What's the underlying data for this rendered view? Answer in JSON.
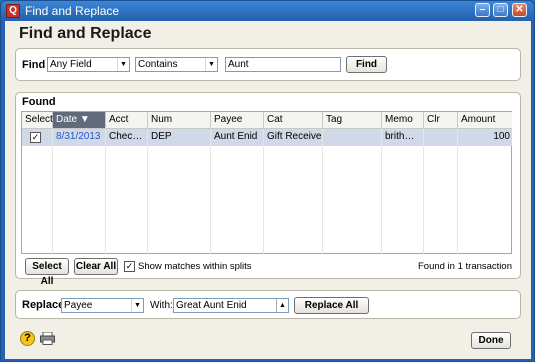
{
  "window": {
    "title": "Find and Replace",
    "min_glyph": "–",
    "max_glyph": "□",
    "close_glyph": "✕",
    "app_icon_glyph": "Q"
  },
  "heading": "Find and Replace",
  "find": {
    "label": "Find",
    "field_value": "Any Field",
    "operator_value": "Contains",
    "text_value": "Aunt",
    "button_label": "Find"
  },
  "found": {
    "label": "Found",
    "columns": [
      "Select",
      "Date ▼",
      "Acct",
      "Num",
      "Payee",
      "Cat",
      "Tag",
      "Memo",
      "Clr",
      "Amount"
    ],
    "rows": [
      {
        "select": "✓",
        "date": "8/31/2013",
        "acct": "Chec…",
        "num": "DEP",
        "payee": "Aunt Enid",
        "cat": "Gift Received",
        "tag": "",
        "memo": "brith…",
        "clr": "",
        "amount": "100"
      }
    ],
    "select_all_label": "Select All",
    "clear_all_label": "Clear All",
    "show_matches_label": "Show matches within splits",
    "show_matches_checked": "✓",
    "status": "Found in 1 transaction"
  },
  "replace": {
    "label": "Replace",
    "field_value": "Payee",
    "with_label": "With:",
    "with_value": "Great Aunt Enid",
    "replace_all_label": "Replace All"
  },
  "footer": {
    "help_glyph": "?",
    "done_label": "Done"
  },
  "colors": {
    "title_bar": "#2563b0",
    "selected_row": "#cfd9e8",
    "date_link": "#2a58c8"
  }
}
